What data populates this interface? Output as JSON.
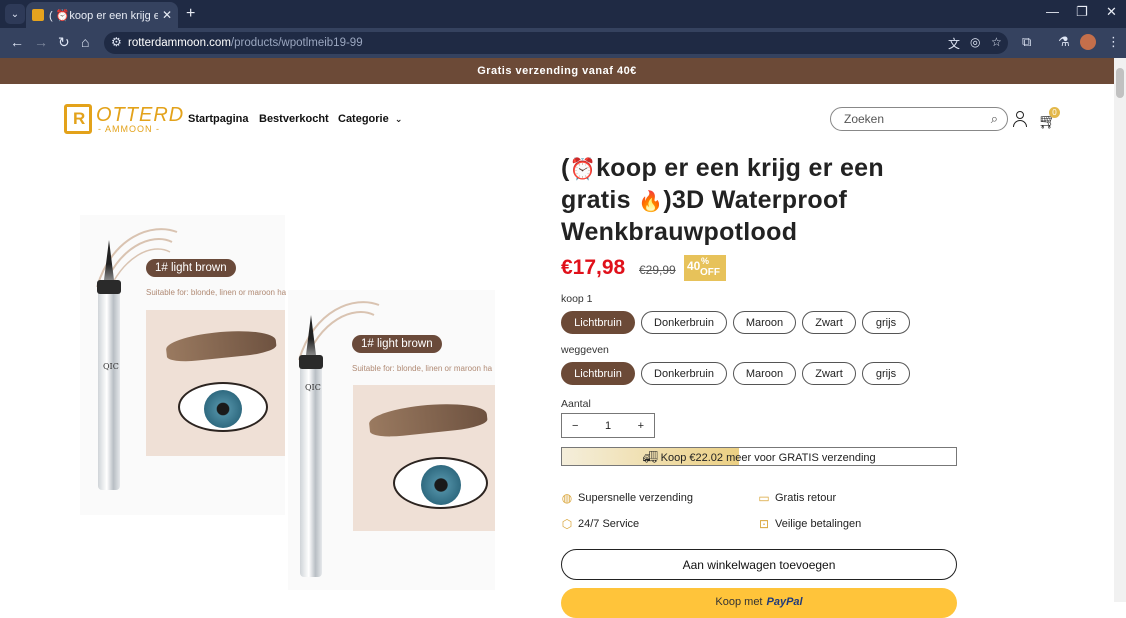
{
  "browser": {
    "tab_title": "( ⏰koop er een krijg er een gra",
    "url_host": "rotterdammoon.com",
    "url_path": "/products/wpotlmeib19-99"
  },
  "announcement": "Gratis verzending vanaf 40€",
  "header": {
    "logo_line1": "OTTERD",
    "logo_line2": "- AMMOON -",
    "logo_mark": "R",
    "menu": [
      "Startpagina",
      "Bestverkocht",
      "Categorie"
    ],
    "search_placeholder": "Zoeken",
    "cart_count": "0"
  },
  "images": {
    "shade_label": "1# light brown",
    "suitable": "Suitable for: blonde, linen or maroon ha",
    "brand": "QIC"
  },
  "product": {
    "title_prefix": "(",
    "title_emoji1": "⏰",
    "title_part1": "koop er een krijg er een gratis",
    "title_emoji2": "🔥",
    "title_part2": ")3D Waterproof",
    "title_line3": "Wenkbrauwpotlood",
    "price": "€17,98",
    "compare_price": "€29,99",
    "discount_num": "40",
    "discount_pct": "%",
    "discount_off": "OFF",
    "option1_label": "koop 1",
    "option2_label": "weggeven",
    "colors": [
      "Lichtbruin",
      "Donkerbruin",
      "Maroon",
      "Zwart",
      "grijs"
    ],
    "qty_label": "Aantal",
    "qty_value": "1",
    "qty_minus": "−",
    "qty_plus": "+",
    "shipping_msg": "Koop €22.02 meer voor GRATIS verzending",
    "shipping_progress": 0.45,
    "features": [
      "Supersnelle verzending",
      "Gratis retour",
      "24/7 Service",
      "Veilige betalingen"
    ],
    "add_to_cart": "Aan winkelwagen toevoegen",
    "paypal_prefix": "Koop met",
    "paypal_brand": "PayPal"
  },
  "colors": {
    "brand_brown": "#6c4a37",
    "price_red": "#e0101a",
    "logo_gold": "#e3a21a",
    "paypal_yellow": "#ffc43a"
  }
}
